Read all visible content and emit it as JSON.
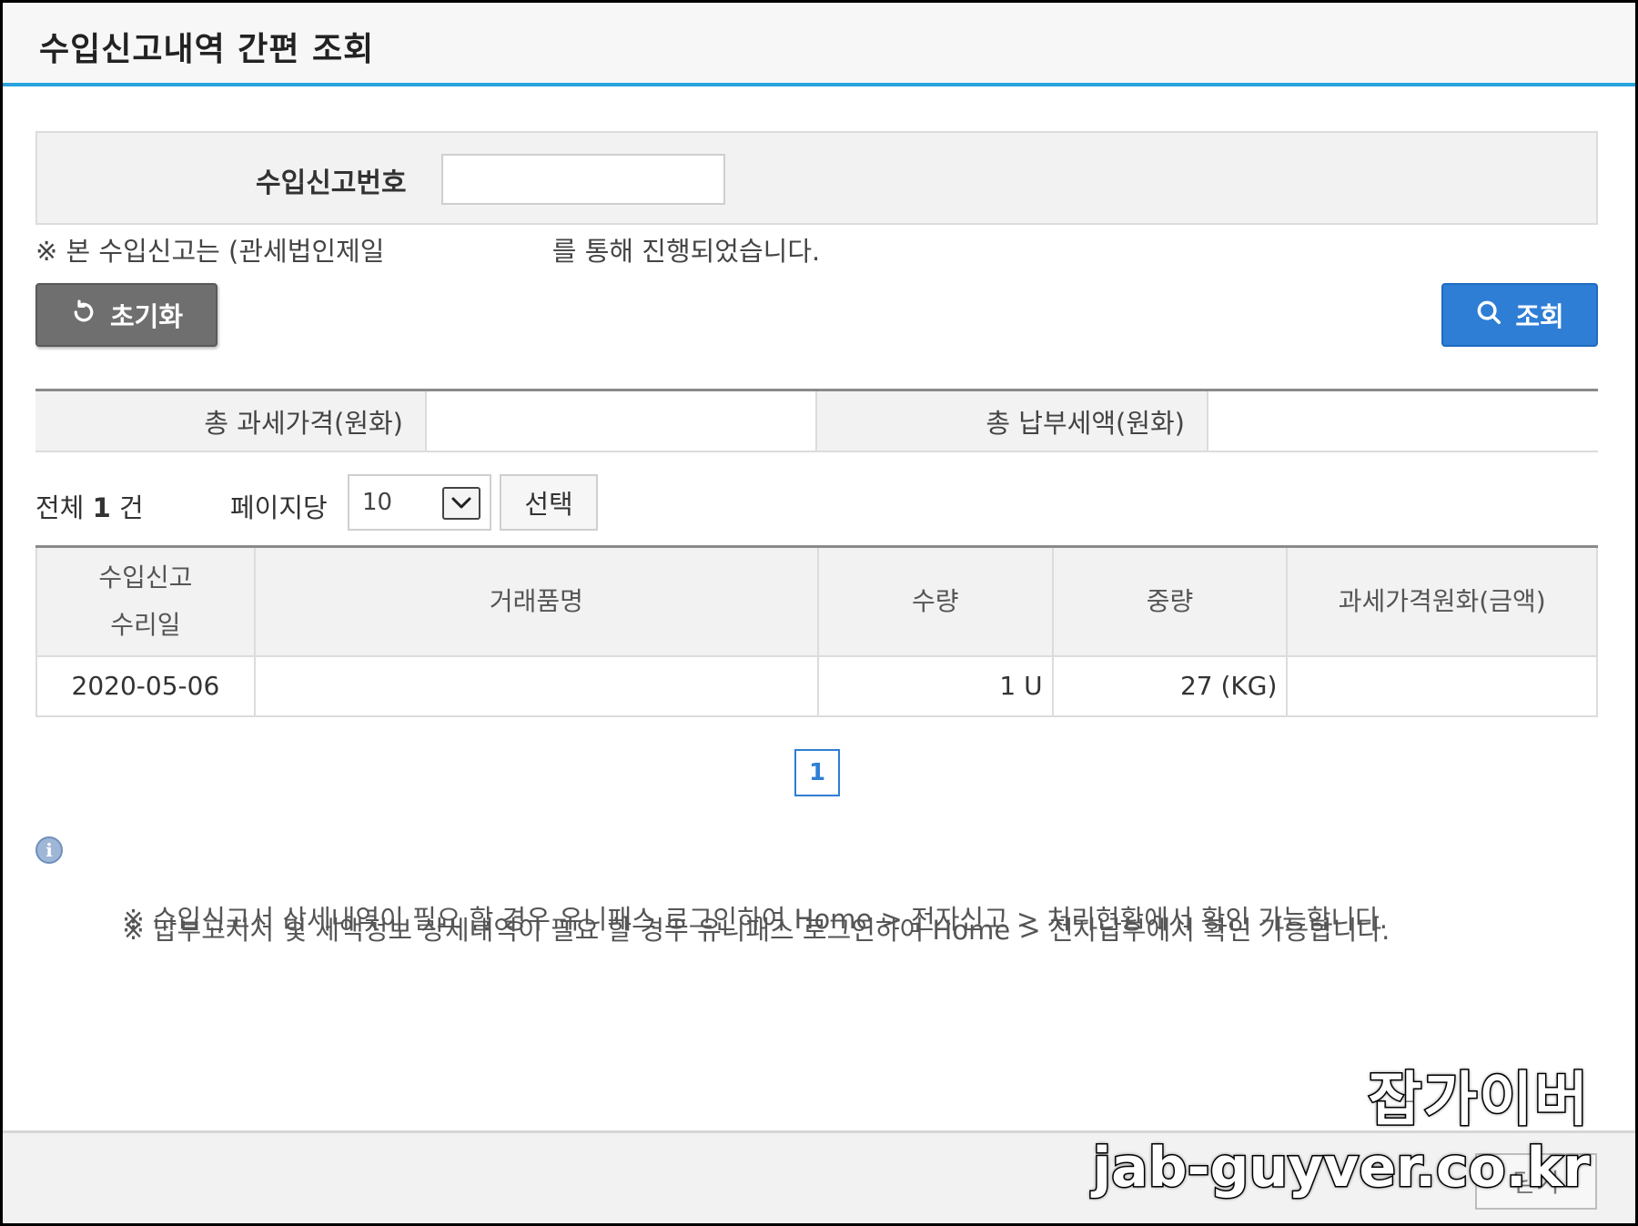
{
  "window": {
    "title": "수입신고내역 간편 조회"
  },
  "search": {
    "label": "수입신고번호",
    "value": "",
    "placeholder": ""
  },
  "notice": "※ 본 수입신고는 (관세법인제일                    를 통해 진행되었습니다.",
  "buttons": {
    "reset_label": "초기화",
    "reset_icon": "refresh-icon",
    "search_label": "조회",
    "search_icon": "search-icon",
    "select_label": "선택",
    "close_label": "닫기"
  },
  "summary": {
    "total_taxable_label": "총 과세가격(원화)",
    "total_taxable_value": "",
    "total_tax_label": "총 납부세액(원화)",
    "total_tax_value": ""
  },
  "listing": {
    "total_prefix": "전체",
    "total_count": "1",
    "total_suffix": "건",
    "per_page_label": "페이지당",
    "per_page_value": "10"
  },
  "table": {
    "headers": [
      "수입신고\n수리일",
      "거래품명",
      "수량",
      "중량",
      "과세가격원화(금액)"
    ],
    "rows": [
      {
        "date": "2020-05-06",
        "item": "",
        "quantity": "1 U",
        "weight": "27 (KG)",
        "amount": ""
      }
    ]
  },
  "pagination": {
    "current": "1"
  },
  "info": {
    "line1": "※ 수입신고서 상세내역이 필요 할 경우 유니패스 로그인하여 Home > 전자신고 > 처리현황에서 확인 가능합니다.",
    "line2": "※ 납부고지서 및 세액정보 상세내역이 필요 할 경우 유니패스 로그인하여 Home > 전자납부에서 확인 가능합니다."
  },
  "watermark": {
    "name": "잡가이버",
    "url": "jab-guyver.co.kr"
  },
  "colors": {
    "accent": "#28a3dd",
    "primary_button": "#2e7ed6",
    "reset_button": "#6f6f6f"
  }
}
